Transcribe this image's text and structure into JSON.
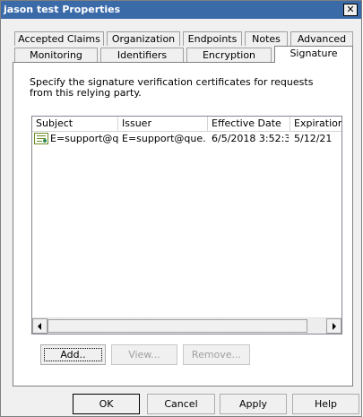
{
  "window": {
    "title": "jason test Properties",
    "close_glyph": "✕"
  },
  "tabs": {
    "row1": [
      "Accepted Claims",
      "Organization",
      "Endpoints",
      "Notes",
      "Advanced"
    ],
    "row2": [
      "Monitoring",
      "Identifiers",
      "Encryption",
      "Signature"
    ],
    "selected": "Signature"
  },
  "signature": {
    "description": "Specify the signature verification certificates for requests from this relying party.",
    "columns": [
      "Subject",
      "Issuer",
      "Effective Date",
      "Expiration"
    ],
    "rows": [
      {
        "subject": "E=support@q...",
        "issuer": "E=support@que...",
        "effective_date": "6/5/2018 3:52:3...",
        "expiration": "5/12/21"
      }
    ],
    "buttons": {
      "add": "Add..",
      "view": "View...",
      "remove": "Remove..."
    }
  },
  "dialog_buttons": {
    "ok": "OK",
    "cancel": "Cancel",
    "apply": "Apply",
    "help": "Help"
  },
  "icons": {
    "row_icon": "certificate-icon"
  }
}
